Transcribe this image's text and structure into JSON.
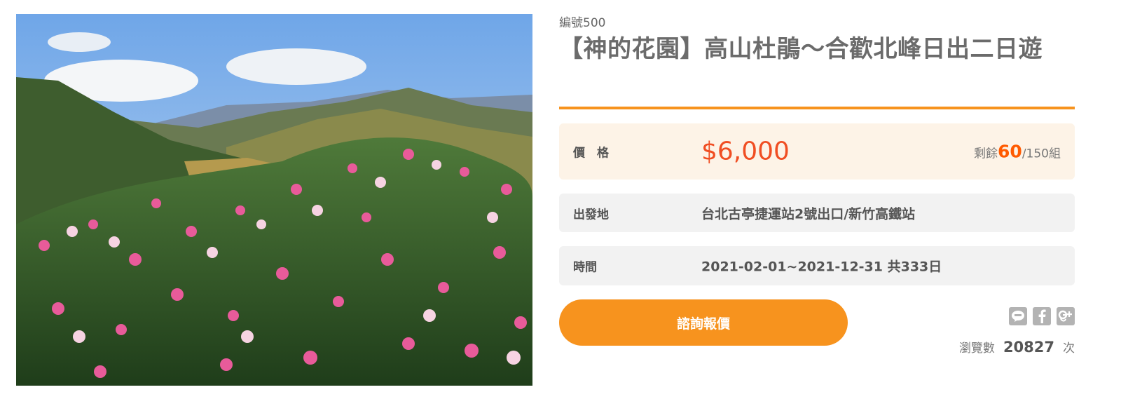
{
  "product": {
    "code": "編號500",
    "title": "【神的花園】高山杜鵑～合歡北峰日出二日遊"
  },
  "price": {
    "label": "價　格",
    "value": "$6,000",
    "remain_prefix": "剩餘",
    "remain_count": "60",
    "remain_suffix": "/150組"
  },
  "departure": {
    "label": "出發地",
    "value": "台北古亭捷運站2號出口/新竹高鐵站"
  },
  "time": {
    "label": "時間",
    "value": "2021-02-01~2021-12-31 共333日"
  },
  "actions": {
    "inquire_label": "諮詢報價"
  },
  "share_icons": [
    "line-icon",
    "facebook-icon",
    "google-plus-icon"
  ],
  "stats": {
    "views_label": "瀏覽數",
    "views_count": "20827",
    "views_unit": "次"
  },
  "colors": {
    "accent": "#f7931e",
    "price": "#f04e23",
    "remain_count": "#ff5a00",
    "price_row_bg": "#fdf3e7",
    "row_bg": "#f2f2f2"
  }
}
